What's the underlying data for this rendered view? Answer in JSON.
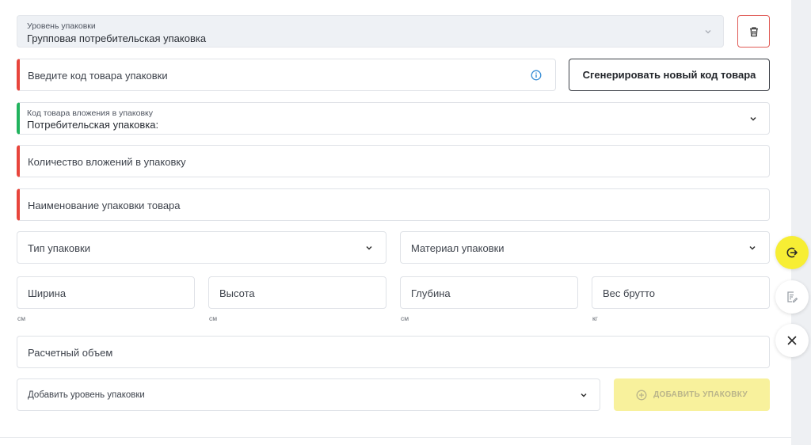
{
  "level": {
    "label": "Уровень упаковки",
    "value": "Групповая потребительская упаковка"
  },
  "product_code": {
    "placeholder": "Введите код товара упаковки",
    "generate_label": "Сгенерировать новый код товара"
  },
  "nested_code": {
    "label": "Код товара вложения в упаковку",
    "value": "Потребительская упаковка:"
  },
  "count": {
    "placeholder": "Количество вложений в упаковку"
  },
  "name": {
    "placeholder": "Наименование упаковки товара"
  },
  "pack_type": {
    "placeholder": "Тип упаковки"
  },
  "material": {
    "placeholder": "Материал упаковки"
  },
  "dimensions": [
    {
      "placeholder": "Ширина",
      "unit": "см"
    },
    {
      "placeholder": "Высота",
      "unit": "см"
    },
    {
      "placeholder": "Глубина",
      "unit": "см"
    },
    {
      "placeholder": "Вес брутто",
      "unit": "кг"
    }
  ],
  "volume": {
    "placeholder": "Расчетный объем"
  },
  "add_level": {
    "placeholder": "Добавить уровень упаковки",
    "button_label": "ДОБАВИТЬ УПАКОВКУ"
  },
  "icons": {
    "delete": "trash-icon",
    "info": "info-icon",
    "fab_1": "logout-icon",
    "fab_2": "document-edit-icon",
    "fab_3": "close-icon"
  },
  "colors": {
    "error": "#e8453c",
    "success": "#22b35e",
    "accent": "#f7ee34",
    "add_button": "#f8f19c",
    "info": "#3a8fd6"
  }
}
